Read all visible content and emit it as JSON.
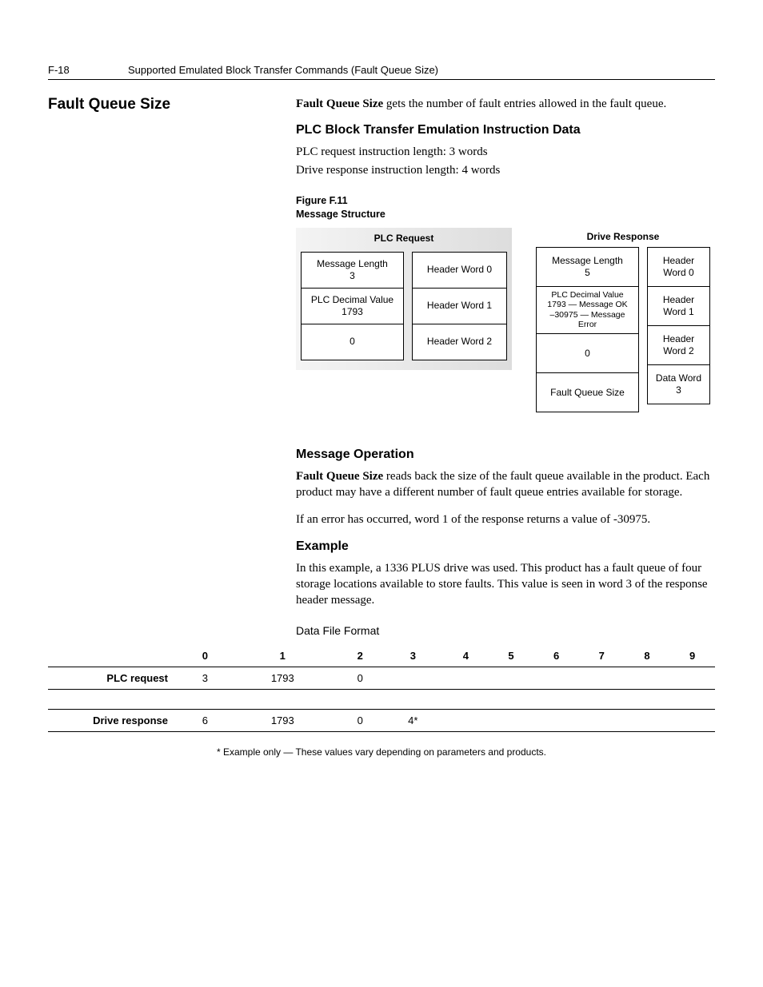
{
  "page": {
    "number": "F-18",
    "header": "Supported Emulated Block Transfer Commands (Fault Queue Size)"
  },
  "section_title": "Fault Queue Size",
  "intro": {
    "bold_lead": "Fault Queue Size",
    "rest": " gets the number of fault entries allowed in the fault queue."
  },
  "plc_block": {
    "heading": "PLC Block Transfer Emulation Instruction Data",
    "line1": "PLC request instruction length: 3 words",
    "line2": "Drive response instruction length: 4 words"
  },
  "figure": {
    "caption_line1": "Figure F.11",
    "caption_line2": "Message Structure",
    "plc_request_label": "PLC Request",
    "drive_response_label": "Drive Response",
    "plc_left": [
      "Message Length\n3",
      "PLC Decimal Value\n1793",
      "0"
    ],
    "plc_right": [
      "Header Word 0",
      "Header Word 1",
      "Header Word 2"
    ],
    "drv_left": [
      "Message Length\n5",
      "PLC Decimal Value\n1793 — Message OK\n–30975 — Message Error",
      "0",
      "Fault Queue Size"
    ],
    "drv_right": [
      "Header Word 0",
      "Header Word 1",
      "Header Word 2",
      "Data Word 3"
    ]
  },
  "message_operation": {
    "heading": "Message Operation",
    "p1_bold": "Fault Queue Size",
    "p1_rest": " reads back the size of the fault queue available in the product. Each product may have a different number of fault queue entries available for storage.",
    "p2": "If an error has occurred, word 1 of the response returns a value of -30975."
  },
  "example": {
    "heading": "Example",
    "p1": "In this example, a 1336 PLUS drive was used. This product has a fault queue of four storage locations available to store faults. This value is seen in word 3 of the response header message."
  },
  "data_file": {
    "title": "Data File Format",
    "headers": [
      "0",
      "1",
      "2",
      "3",
      "4",
      "5",
      "6",
      "7",
      "8",
      "9"
    ],
    "rows": [
      {
        "label": "PLC request",
        "cells": [
          "3",
          "1793",
          "0",
          "",
          "",
          "",
          "",
          "",
          "",
          ""
        ]
      },
      {
        "label": "Drive response",
        "cells": [
          "6",
          "1793",
          "0",
          "4*",
          "",
          "",
          "",
          "",
          "",
          ""
        ]
      }
    ],
    "footnote": "* Example only — These values vary depending on parameters and products."
  },
  "chart_data": {
    "type": "table",
    "title": "Data File Format",
    "columns": [
      "0",
      "1",
      "2",
      "3",
      "4",
      "5",
      "6",
      "7",
      "8",
      "9"
    ],
    "series": [
      {
        "name": "PLC request",
        "values": [
          3,
          1793,
          0,
          null,
          null,
          null,
          null,
          null,
          null,
          null
        ]
      },
      {
        "name": "Drive response",
        "values": [
          6,
          1793,
          0,
          4,
          null,
          null,
          null,
          null,
          null,
          null
        ]
      }
    ],
    "note": "Value at Drive response column 3 is example-only (marked with *)."
  }
}
